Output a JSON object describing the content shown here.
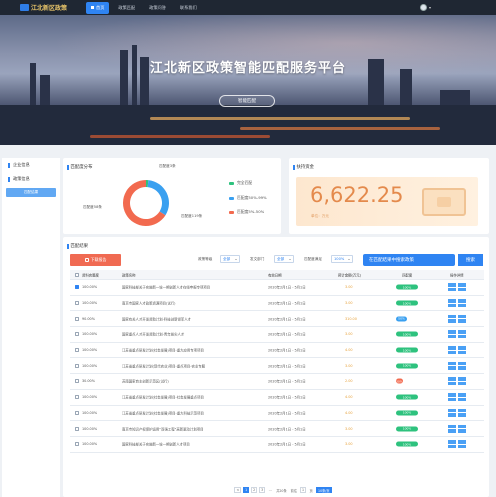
{
  "topbar": {
    "logo": "江北新区政策",
    "nav": [
      {
        "label": "首页",
        "active": true
      },
      {
        "label": "政策匹配",
        "active": false
      },
      {
        "label": "政策问答",
        "active": false
      },
      {
        "label": "联系我们",
        "active": false
      }
    ]
  },
  "hero": {
    "title": "江北新区政策智能匹配服务平台",
    "cta": "智能匹配"
  },
  "sidebar": {
    "items": [
      {
        "label": "企业信息"
      },
      {
        "label": "政策信息"
      }
    ],
    "sub": "匹配结果"
  },
  "match_dist": {
    "title": "匹配度分布",
    "labels": {
      "top": "匹配度3条",
      "left": "匹配度58条",
      "right": "匹配度119条"
    },
    "legend": [
      {
        "label": "完全匹配",
        "color": "#2ec27e"
      },
      {
        "label": "匹配度50%-99%",
        "color": "#3aa0f0"
      },
      {
        "label": "匹配度5%-50%",
        "color": "#f26a4f"
      }
    ],
    "chart_data": {
      "type": "pie",
      "values": [
        3,
        58,
        119
      ],
      "labels": [
        "匹配度3条",
        "匹配度58条",
        "匹配度119条"
      ],
      "colors": [
        "#2ec27e",
        "#3aa0f0",
        "#f26a4f"
      ]
    }
  },
  "fund": {
    "title": "扶持资金",
    "value": "6,622.25",
    "unit": "单位：万元"
  },
  "results": {
    "title": "匹配结果",
    "download": "下载报告",
    "filters": [
      {
        "label": "政策等级",
        "value": "全部"
      },
      {
        "label": "发文部门",
        "value": "全部"
      },
      {
        "label": "匹配度满足",
        "value": "100%"
      }
    ],
    "search_placeholder": "在匹配结果中搜索政策",
    "search_btn": "搜索",
    "columns": [
      "资料完整度",
      "政策名称",
      "有效日期",
      "预计金额(万元)",
      "匹配度",
      "操作详情"
    ],
    "rows": [
      {
        "checked": true,
        "completeness": "100.00%",
        "name": "国家科技部关于实施新一轮一期创新人才在线申报专项项目",
        "date": "2020年2月1日 - 5月1日",
        "amount": "3.00",
        "match": "100%",
        "mcolor": "#2ec27e",
        "acts": 4
      },
      {
        "checked": false,
        "completeness": "100.00%",
        "name": "南京市国家人才政策资源项目(试行)",
        "date": "2020年2月1日 - 5月1日",
        "amount": "3.00",
        "match": "100%",
        "mcolor": "#2ec27e",
        "acts": 4
      },
      {
        "checked": false,
        "completeness": "90.00%",
        "name": "国家有关人才开发资助计划-科技创新领军人才",
        "date": "2020年2月1日 - 5月1日",
        "amount": "310.00",
        "match": "50%",
        "mcolor": "#3aa0f0",
        "acts": 4
      },
      {
        "checked": false,
        "completeness": "100.00%",
        "name": "国家重点人才开发资助计划-青年拔尖人才",
        "date": "2020年2月1日 - 5月1日",
        "amount": "3.00",
        "match": "100%",
        "mcolor": "#2ec27e",
        "acts": 4
      },
      {
        "checked": false,
        "completeness": "100.00%",
        "name": "江苏省重点研发计划(社会发展)项目-重大应用专项项目",
        "date": "2020年2月1日 - 5月1日",
        "amount": "4.00",
        "match": "100%",
        "mcolor": "#2ec27e",
        "acts": 4
      },
      {
        "checked": false,
        "completeness": "100.00%",
        "name": "江苏省重点研发计划(现代农业)项目-重点项目-农业专题",
        "date": "2020年2月1日 - 5月1日",
        "amount": "3.00",
        "match": "100%",
        "mcolor": "#2ec27e",
        "acts": 4
      },
      {
        "checked": false,
        "completeness": "30.00%",
        "name": "苏南国家自主创新示范区(试行)",
        "date": "2020年2月1日 - 5月1日",
        "amount": "2.00",
        "match": "30%",
        "mcolor": "#f26a4f",
        "acts": 4
      },
      {
        "checked": false,
        "completeness": "100.00%",
        "name": "江苏省重点研发计划(社会发展)项目-社会发展重点项目",
        "date": "2020年2月1日 - 5月1日",
        "amount": "4.00",
        "match": "100%",
        "mcolor": "#2ec27e",
        "acts": 4
      },
      {
        "checked": false,
        "completeness": "100.00%",
        "name": "江苏省重点研发计划(社会发展)项目-重大科技示范项目",
        "date": "2020年2月1日 - 5月1日",
        "amount": "4.00",
        "match": "100%",
        "mcolor": "#2ec27e",
        "acts": 4
      },
      {
        "checked": false,
        "completeness": "100.00%",
        "name": "南京市知识产权保护运用“双强工程”高新驱动计划项目",
        "date": "2020年2月1日 - 5月1日",
        "amount": "3.00",
        "match": "100%",
        "mcolor": "#2ec27e",
        "acts": 4
      },
      {
        "checked": false,
        "completeness": "100.00%",
        "name": "国家科技部关于实施新一轮一期创新人才项目",
        "date": "2020年2月1日 - 5月1日",
        "amount": "3.00",
        "match": "100%",
        "mcolor": "#2ec27e",
        "acts": 4
      }
    ]
  },
  "pager": {
    "prev": "<",
    "pages": [
      "1",
      "2",
      "3"
    ],
    "ellipsis": "...",
    "total": "共20条",
    "jump": "前往",
    "jump_page": "1",
    "jump_unit": "页",
    "size": "10条/页"
  }
}
